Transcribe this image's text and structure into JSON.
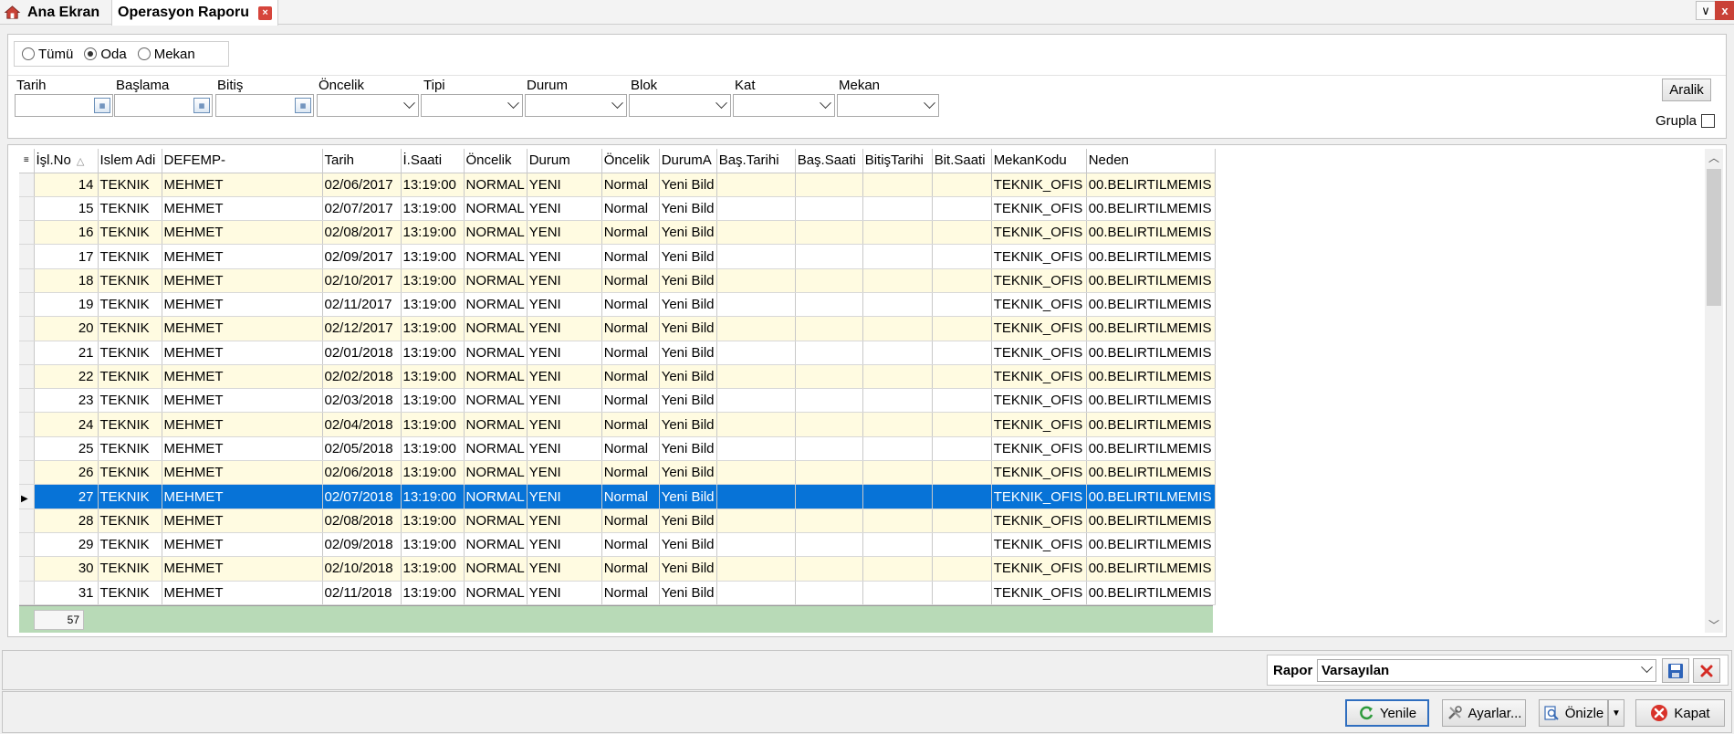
{
  "tabs": {
    "home": "Ana Ekran",
    "active": "Operasyon Raporu",
    "close_glyph": "×"
  },
  "window": {
    "dropdown_glyph": "∨",
    "close_glyph": "x"
  },
  "filters": {
    "radios": [
      {
        "label": "Tümü",
        "selected": false
      },
      {
        "label": "Oda",
        "selected": true
      },
      {
        "label": "Mekan",
        "selected": false
      }
    ],
    "labels": {
      "tarih": "Tarih",
      "baslama": "Başlama",
      "bitis": "Bitiş",
      "oncelik": "Öncelik",
      "tipi": "Tipi",
      "durum": "Durum",
      "blok": "Blok",
      "kat": "Kat",
      "mekan": "Mekan"
    },
    "aralik_label": "Aralik",
    "grupla_label": "Grupla"
  },
  "grid": {
    "columns": [
      "İşl.No",
      "Islem Adi",
      "DEFEMP-",
      "Tarih",
      "İ.Saati",
      "Öncelik",
      "Durum",
      "Öncelik",
      "DurumA",
      "Baş.Tarihi",
      "Baş.Saati",
      "BitişTarihi",
      "Bit.Saati",
      "MekanKodu",
      "Neden"
    ],
    "sort_glyph": "△",
    "rows": [
      [
        "14",
        "TEKNIK",
        "MEHMET",
        "02/06/2017",
        "13:19:00",
        "NORMAL",
        "YENI",
        "Normal",
        "Yeni Bild",
        "",
        "",
        "",
        "",
        "TEKNIK_OFIS",
        "00.BELIRTILMEMIS"
      ],
      [
        "15",
        "TEKNIK",
        "MEHMET",
        "02/07/2017",
        "13:19:00",
        "NORMAL",
        "YENI",
        "Normal",
        "Yeni Bild",
        "",
        "",
        "",
        "",
        "TEKNIK_OFIS",
        "00.BELIRTILMEMIS"
      ],
      [
        "16",
        "TEKNIK",
        "MEHMET",
        "02/08/2017",
        "13:19:00",
        "NORMAL",
        "YENI",
        "Normal",
        "Yeni Bild",
        "",
        "",
        "",
        "",
        "TEKNIK_OFIS",
        "00.BELIRTILMEMIS"
      ],
      [
        "17",
        "TEKNIK",
        "MEHMET",
        "02/09/2017",
        "13:19:00",
        "NORMAL",
        "YENI",
        "Normal",
        "Yeni Bild",
        "",
        "",
        "",
        "",
        "TEKNIK_OFIS",
        "00.BELIRTILMEMIS"
      ],
      [
        "18",
        "TEKNIK",
        "MEHMET",
        "02/10/2017",
        "13:19:00",
        "NORMAL",
        "YENI",
        "Normal",
        "Yeni Bild",
        "",
        "",
        "",
        "",
        "TEKNIK_OFIS",
        "00.BELIRTILMEMIS"
      ],
      [
        "19",
        "TEKNIK",
        "MEHMET",
        "02/11/2017",
        "13:19:00",
        "NORMAL",
        "YENI",
        "Normal",
        "Yeni Bild",
        "",
        "",
        "",
        "",
        "TEKNIK_OFIS",
        "00.BELIRTILMEMIS"
      ],
      [
        "20",
        "TEKNIK",
        "MEHMET",
        "02/12/2017",
        "13:19:00",
        "NORMAL",
        "YENI",
        "Normal",
        "Yeni Bild",
        "",
        "",
        "",
        "",
        "TEKNIK_OFIS",
        "00.BELIRTILMEMIS"
      ],
      [
        "21",
        "TEKNIK",
        "MEHMET",
        "02/01/2018",
        "13:19:00",
        "NORMAL",
        "YENI",
        "Normal",
        "Yeni Bild",
        "",
        "",
        "",
        "",
        "TEKNIK_OFIS",
        "00.BELIRTILMEMIS"
      ],
      [
        "22",
        "TEKNIK",
        "MEHMET",
        "02/02/2018",
        "13:19:00",
        "NORMAL",
        "YENI",
        "Normal",
        "Yeni Bild",
        "",
        "",
        "",
        "",
        "TEKNIK_OFIS",
        "00.BELIRTILMEMIS"
      ],
      [
        "23",
        "TEKNIK",
        "MEHMET",
        "02/03/2018",
        "13:19:00",
        "NORMAL",
        "YENI",
        "Normal",
        "Yeni Bild",
        "",
        "",
        "",
        "",
        "TEKNIK_OFIS",
        "00.BELIRTILMEMIS"
      ],
      [
        "24",
        "TEKNIK",
        "MEHMET",
        "02/04/2018",
        "13:19:00",
        "NORMAL",
        "YENI",
        "Normal",
        "Yeni Bild",
        "",
        "",
        "",
        "",
        "TEKNIK_OFIS",
        "00.BELIRTILMEMIS"
      ],
      [
        "25",
        "TEKNIK",
        "MEHMET",
        "02/05/2018",
        "13:19:00",
        "NORMAL",
        "YENI",
        "Normal",
        "Yeni Bild",
        "",
        "",
        "",
        "",
        "TEKNIK_OFIS",
        "00.BELIRTILMEMIS"
      ],
      [
        "26",
        "TEKNIK",
        "MEHMET",
        "02/06/2018",
        "13:19:00",
        "NORMAL",
        "YENI",
        "Normal",
        "Yeni Bild",
        "",
        "",
        "",
        "",
        "TEKNIK_OFIS",
        "00.BELIRTILMEMIS"
      ],
      [
        "27",
        "TEKNIK",
        "MEHMET",
        "02/07/2018",
        "13:19:00",
        "NORMAL",
        "YENI",
        "Normal",
        "Yeni Bild",
        "",
        "",
        "",
        "",
        "TEKNIK_OFIS",
        "00.BELIRTILMEMIS"
      ],
      [
        "28",
        "TEKNIK",
        "MEHMET",
        "02/08/2018",
        "13:19:00",
        "NORMAL",
        "YENI",
        "Normal",
        "Yeni Bild",
        "",
        "",
        "",
        "",
        "TEKNIK_OFIS",
        "00.BELIRTILMEMIS"
      ],
      [
        "29",
        "TEKNIK",
        "MEHMET",
        "02/09/2018",
        "13:19:00",
        "NORMAL",
        "YENI",
        "Normal",
        "Yeni Bild",
        "",
        "",
        "",
        "",
        "TEKNIK_OFIS",
        "00.BELIRTILMEMIS"
      ],
      [
        "30",
        "TEKNIK",
        "MEHMET",
        "02/10/2018",
        "13:19:00",
        "NORMAL",
        "YENI",
        "Normal",
        "Yeni Bild",
        "",
        "",
        "",
        "",
        "TEKNIK_OFIS",
        "00.BELIRTILMEMIS"
      ],
      [
        "31",
        "TEKNIK",
        "MEHMET",
        "02/11/2018",
        "13:19:00",
        "NORMAL",
        "YENI",
        "Normal",
        "Yeni Bild",
        "",
        "",
        "",
        "",
        "TEKNIK_OFIS",
        "00.BELIRTILMEMIS"
      ]
    ],
    "selected_row": 13,
    "footer_count": "57",
    "colors": {
      "odd_row": "#fffbe1",
      "selected": "#0773d7",
      "footer": "#b8dab7"
    }
  },
  "rapor": {
    "label": "Rapor",
    "value": "Varsayılan"
  },
  "actions": {
    "yenile": "Yenile",
    "ayarlar": "Ayarlar...",
    "onizle": "Önizle",
    "kapat": "Kapat"
  }
}
